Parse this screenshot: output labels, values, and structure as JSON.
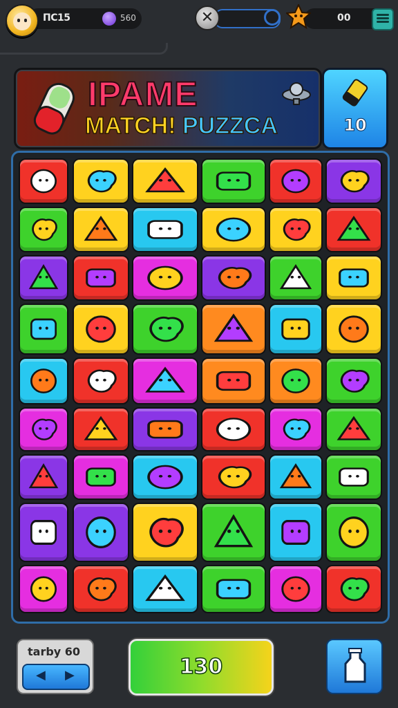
{
  "topbar": {
    "player_name": "ПС15",
    "coins": "560",
    "right_value": "00"
  },
  "banner": {
    "line1": "IPAME",
    "line2_a": "MATCH! ",
    "line2_b": "PUZZCA",
    "counter": "10"
  },
  "footer": {
    "level_label": "tarby 60",
    "left_arrow": "◀",
    "right_arrow": "▶",
    "play_value": "130"
  },
  "colors": {
    "red": "#f0322a",
    "yellow": "#ffd21f",
    "cyan": "#28c8f0",
    "green": "#3ed22c",
    "purple": "#8a36e6",
    "magenta": "#e52ee0",
    "orange": "#ff8a1f"
  },
  "board": {
    "rows": [
      [
        {
          "c": "red",
          "icon": "star-face-icon"
        },
        {
          "c": "yellow",
          "icon": "cloud-face-icon"
        },
        {
          "c": "yellow",
          "icon": "green-bar-icon"
        },
        {
          "c": "green",
          "icon": "fish-icon"
        },
        {
          "c": "red",
          "icon": "blue-swirl-icon"
        },
        {
          "c": "purple",
          "icon": "green-blob-icon"
        }
      ],
      [
        {
          "c": "green",
          "icon": "bottle-icon"
        },
        {
          "c": "yellow",
          "icon": "pink-block-icon"
        },
        {
          "c": "cyan",
          "icon": "red-claw-icon"
        },
        {
          "c": "yellow",
          "icon": "roller-icon"
        },
        {
          "c": "yellow",
          "icon": "keyboard-icon"
        },
        {
          "c": "red",
          "icon": "leaf-icon"
        }
      ],
      [
        {
          "c": "purple",
          "icon": "ring-icon"
        },
        {
          "c": "red",
          "icon": "eraser-icon"
        },
        {
          "c": "magenta",
          "icon": "box-icon"
        },
        {
          "c": "purple",
          "icon": "dino-icon"
        },
        {
          "c": "green",
          "icon": "hex-icon"
        },
        {
          "c": "yellow",
          "icon": "pink-creature-icon"
        }
      ],
      [
        {
          "c": "green",
          "icon": "yellow-blob-icon"
        },
        {
          "c": "yellow",
          "icon": "pencil-icon"
        },
        {
          "c": "green",
          "icon": "red-log-icon"
        },
        {
          "c": "orange",
          "icon": "slipper-icon"
        },
        {
          "c": "cyan",
          "icon": "tower-icon"
        },
        {
          "c": "yellow",
          "icon": "red-critter-icon"
        }
      ],
      [
        {
          "c": "cyan",
          "icon": "green-stick-icon"
        },
        {
          "c": "red",
          "icon": "orange-face-icon"
        },
        {
          "c": "magenta",
          "icon": "heart-icon"
        },
        {
          "c": "orange",
          "icon": "green-bush-icon"
        },
        {
          "c": "orange",
          "icon": "red-whale-icon"
        },
        {
          "c": "green",
          "icon": "green-critter-icon"
        }
      ],
      [
        {
          "c": "magenta",
          "icon": "green-star-icon"
        },
        {
          "c": "red",
          "icon": "flag-icon"
        },
        {
          "c": "purple",
          "icon": "cloud-blue-icon"
        },
        {
          "c": "red",
          "icon": "red-hands-icon"
        },
        {
          "c": "magenta",
          "icon": "blue-face-icon"
        },
        {
          "c": "green",
          "icon": "dots-bar-icon"
        }
      ],
      [
        {
          "c": "purple",
          "icon": "popcorn-icon"
        },
        {
          "c": "magenta",
          "icon": "sun-face-icon"
        },
        {
          "c": "cyan",
          "icon": "orange-ball-icon"
        },
        {
          "c": "red",
          "icon": "red-ball-icon"
        },
        {
          "c": "cyan",
          "icon": "spiral-icon"
        },
        {
          "c": "green",
          "icon": "three-dots-icon"
        }
      ],
      [
        {
          "c": "purple",
          "icon": "magenta-cat-icon"
        },
        {
          "c": "purple",
          "icon": "green-alien-icon"
        },
        {
          "c": "yellow",
          "icon": "red-glove-icon"
        },
        {
          "c": "green",
          "icon": "brush-icon"
        },
        {
          "c": "cyan",
          "icon": "lipstick-icon"
        },
        {
          "c": "green",
          "icon": "orange-figure-icon"
        }
      ],
      [
        {
          "c": "magenta",
          "icon": "check-icon"
        },
        {
          "c": "red",
          "icon": "green-dino-icon"
        },
        {
          "c": "cyan",
          "icon": "fruit-row-icon"
        },
        {
          "c": "green",
          "icon": "bag-icon"
        },
        {
          "c": "magenta",
          "icon": "speech-icon"
        },
        {
          "c": "red",
          "icon": "pink-eraser-icon"
        }
      ]
    ]
  }
}
